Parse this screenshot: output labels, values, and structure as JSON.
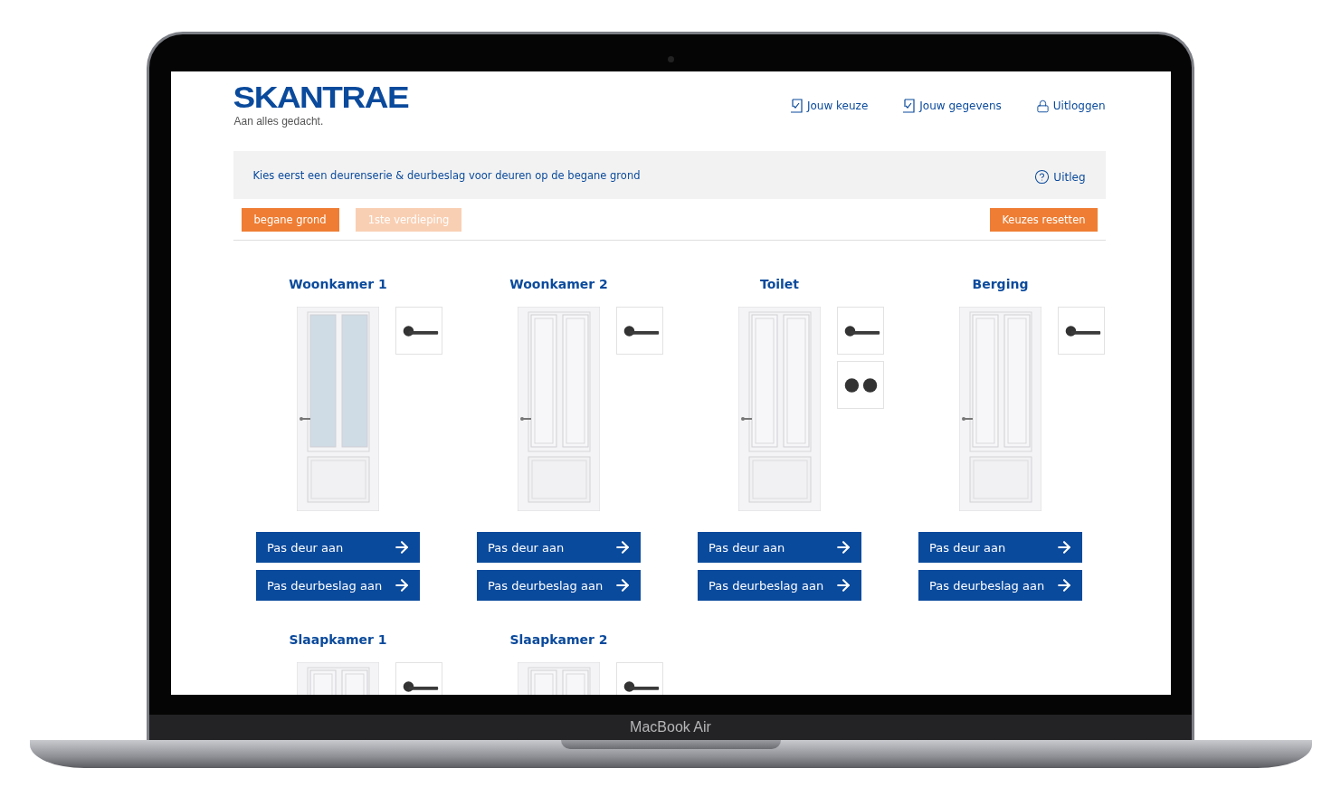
{
  "device": {
    "label": "MacBook Air"
  },
  "header": {
    "logo": "SKANTRAE",
    "tagline": "Aan alles gedacht.",
    "nav": [
      {
        "label": "Jouw keuze",
        "kind": "doc"
      },
      {
        "label": "Jouw gegevens",
        "kind": "doc"
      },
      {
        "label": "Uitloggen",
        "kind": "lock"
      }
    ]
  },
  "info_bar": {
    "text": "Kies eerst een deurenserie & deurbeslag voor deuren op de begane grond",
    "help": "Uitleg"
  },
  "floor_tabs": [
    {
      "label": "begane grond",
      "selected": true
    },
    {
      "label": "1ste verdieping",
      "selected": false
    }
  ],
  "reset_button": "Keuzes resetten",
  "rooms": [
    {
      "name": "Woonkamer 1",
      "glazed": true,
      "hardware": [
        {
          "kind": "lever"
        }
      ],
      "buttons": [
        "Pas deur aan",
        "Pas deurbeslag aan"
      ]
    },
    {
      "name": "Woonkamer 2",
      "glazed": false,
      "hardware": [
        {
          "kind": "lever"
        }
      ],
      "buttons": [
        "Pas deur aan",
        "Pas deurbeslag aan"
      ]
    },
    {
      "name": "Toilet",
      "glazed": false,
      "hardware": [
        {
          "kind": "lever"
        },
        {
          "kind": "rosettes"
        }
      ],
      "buttons": [
        "Pas deur aan",
        "Pas deurbeslag aan"
      ]
    },
    {
      "name": "Berging",
      "glazed": false,
      "hardware": [
        {
          "kind": "lever"
        }
      ],
      "buttons": [
        "Pas deur aan",
        "Pas deurbeslag aan"
      ]
    },
    {
      "name": "Slaapkamer 1",
      "glazed": false,
      "hardware": [
        {
          "kind": "lever"
        }
      ]
    },
    {
      "name": "Slaapkamer 2",
      "glazed": false,
      "hardware": [
        {
          "kind": "lever"
        }
      ]
    }
  ]
}
